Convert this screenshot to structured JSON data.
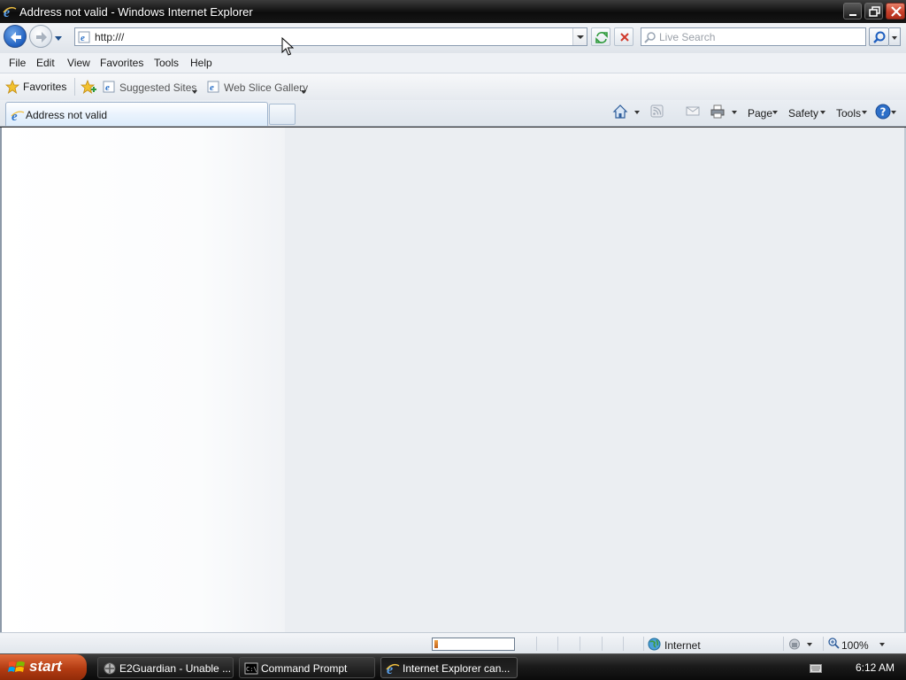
{
  "window": {
    "title": "Address not valid - Windows Internet Explorer"
  },
  "address_bar": {
    "url": "http:///"
  },
  "search": {
    "placeholder": "Live Search"
  },
  "menu": {
    "items": [
      "File",
      "Edit",
      "View",
      "Favorites",
      "Tools",
      "Help"
    ]
  },
  "favorites_bar": {
    "favorites_label": "Favorites",
    "suggested_sites": "Suggested Sites",
    "web_slice_gallery": "Web Slice Gallery"
  },
  "tabs": {
    "active_label": "Address not valid"
  },
  "command_bar": {
    "page": "Page",
    "safety": "Safety",
    "tools": "Tools"
  },
  "status_bar": {
    "progress": 0.05,
    "zone": "Internet",
    "zoom": "100%"
  },
  "taskbar": {
    "start_label": "start",
    "buttons": [
      {
        "label": "E2Guardian - Unable ...",
        "icon": "e2guardian-icon",
        "active": false
      },
      {
        "label": "Command Prompt",
        "icon": "command-prompt-icon",
        "active": false
      },
      {
        "label": "Internet Explorer can...",
        "icon": "internet-explorer-icon",
        "active": true
      }
    ],
    "clock": "6:12 AM"
  },
  "colors": {
    "ie_blue": "#1f5fbf",
    "close_red": "#c7402a",
    "start_orange": "#b23b12"
  }
}
